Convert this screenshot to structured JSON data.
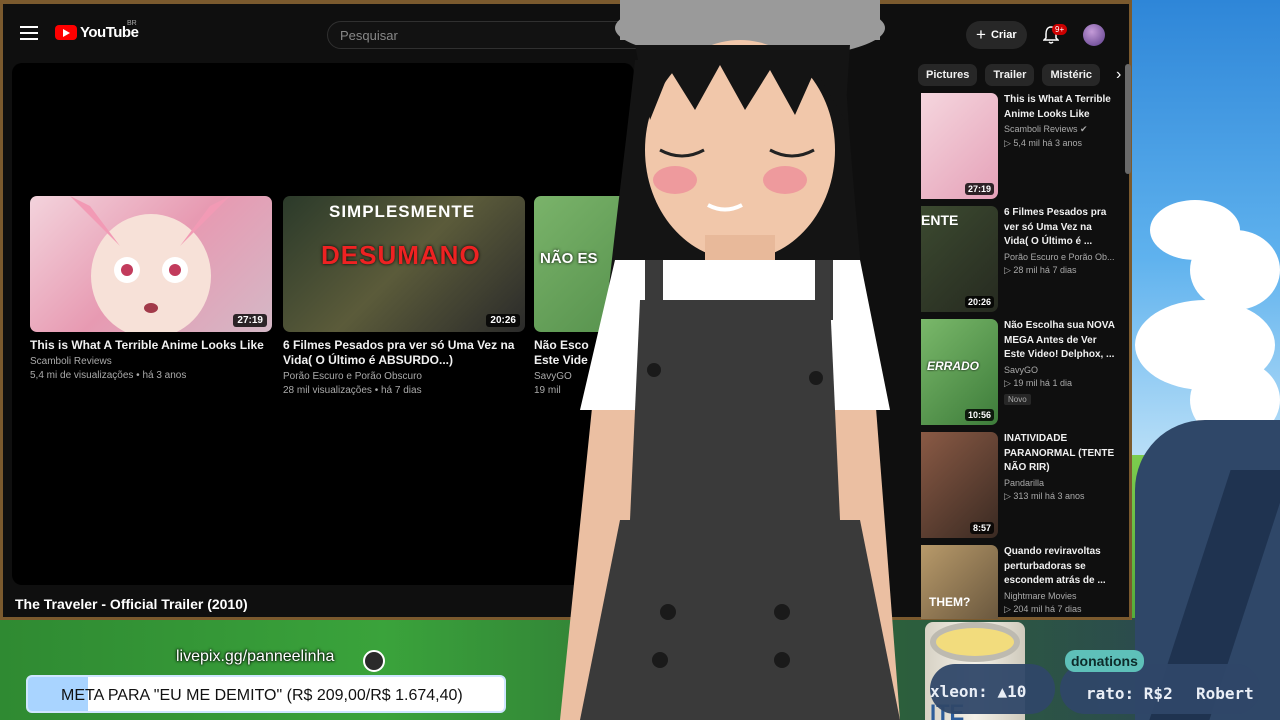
{
  "youtube": {
    "logo_text": "YouTube",
    "region": "BR",
    "search_placeholder": "Pesquisar",
    "create_label": "Criar",
    "notifications_badge": "9+",
    "player_video_title": "The Traveler - Official Trailer (2010)",
    "endscreen": [
      {
        "title_line1": "This is What A Terrible Anime Looks Like",
        "title_line2": "",
        "channel": "Scamboli Reviews",
        "meta": "5,4 mi de visualizações • há 3 anos",
        "duration": "27:19",
        "thumb_color": "#e9b8c6",
        "thumb_text": ""
      },
      {
        "title_line1": "6 Filmes Pesados pra ver só Uma Vez na",
        "title_line2": "Vida( O Último é ABSURDO...)",
        "channel": "Porão Escuro e Porão Obscuro",
        "meta": "28 mil visualizações • há 7 dias",
        "duration": "20:26",
        "thumb_color": "#3c4a30",
        "thumb_text": "SIMPLESMENTE"
      },
      {
        "title_line1": "Não Esco",
        "title_line2": "Este Vide",
        "channel": "SavyGO",
        "meta": "19 mil",
        "duration": "",
        "thumb_color": "#5a8f4a",
        "thumb_text": "NÃO ES"
      }
    ],
    "endscreen_thumb2_overlay": "DESUMANO",
    "chips": [
      "Pictures",
      "Trailer",
      "Mistéric"
    ],
    "related": [
      {
        "title": "This is What A Terrible Anime Looks Like",
        "channel": "Scamboli Reviews",
        "verified": true,
        "meta": "5,4 mil  há 3 anos",
        "duration": "27:19",
        "thumb_color": "#e7b4c2",
        "badge": ""
      },
      {
        "title": "6 Filmes Pesados pra ver só Uma Vez na Vida( O Último é ...",
        "channel": "Porão Escuro e Porão Ob...",
        "verified": false,
        "meta": "28 mil  há 7 dias",
        "duration": "20:26",
        "thumb_color": "#3b4a2e",
        "badge": ""
      },
      {
        "title": "Não Escolha sua NOVA MEGA Antes de Ver Este Video! Delphox, ...",
        "channel": "SavyGO",
        "verified": false,
        "meta": "19 mil  há 1 dia",
        "duration": "10:56",
        "thumb_color": "#4f8f48",
        "badge": "Novo"
      },
      {
        "title": "INATIVIDADE PARANORMAL (TENTE NÃO RIR)",
        "channel": "Pandarilla",
        "verified": false,
        "meta": "313 mil  há 3 anos",
        "duration": "8:57",
        "thumb_color": "#6b4a3a",
        "badge": ""
      },
      {
        "title": "Quando reviravoltas perturbadoras se escondem atrás de ...",
        "channel": "Nightmare Movies",
        "verified": false,
        "meta": "204 mil  há 7 dias",
        "duration": "",
        "thumb_color": "#8a7a55",
        "badge": ""
      }
    ]
  },
  "related_thumb_texts": [
    "",
    "ENTE",
    "ERRADO",
    "",
    "THEM?"
  ],
  "overlay": {
    "livepix_url": "livepix.gg/panneelinha",
    "goal_text": "META PARA \"EU ME DEMITO\" (R$ 209,00/R$ 1.674,40)",
    "goal_progress": 0.125,
    "donations_label": "donations",
    "ticker_1": "xleon: ",
    "ticker_1_amount": "10",
    "ticker_2": "rato: R$2",
    "ticker_3": "Robert",
    "can_label": "ITE"
  },
  "colors": {
    "frame": "#7b5a2e",
    "yt_bg": "#0f0f0f",
    "yt_red": "#ff0000",
    "goal_fill": "#a9d4ff",
    "donations": "#5ec0b9"
  }
}
